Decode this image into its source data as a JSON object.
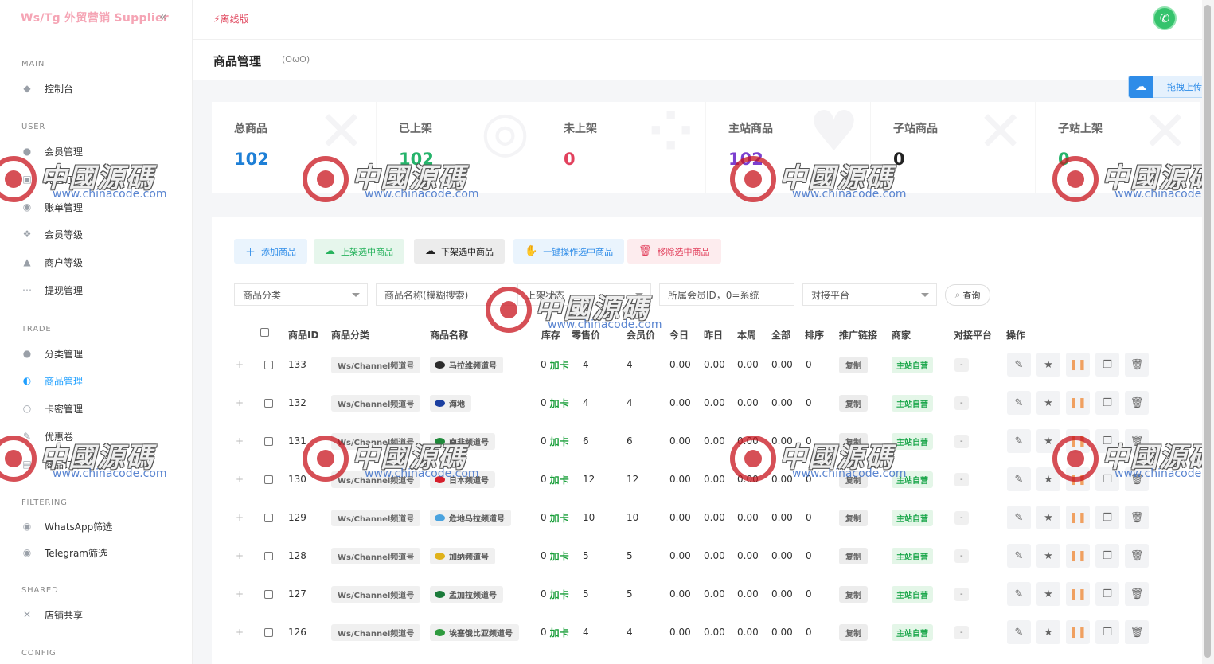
{
  "sidebar": {
    "brand": "Ws/Tg 外贸营销 Supplier",
    "sections": {
      "main": "MAIN",
      "user": "USER",
      "trade": "TRADE",
      "filtering": "FILTERING",
      "shared": "SHARED",
      "config": "CONFIG"
    },
    "items": {
      "dashboard": "控制台",
      "members": "会员管理",
      "recharge": "充值订单",
      "bills": "账单管理",
      "member_level": "会员等级",
      "merchant_level": "商户等级",
      "withdraw": "提现管理",
      "category": "分类管理",
      "products": "商品管理",
      "cardkeys": "卡密管理",
      "coupons": "优惠卷",
      "orders": "商品订单",
      "whatsapp": "WhatsApp筛选",
      "telegram": "Telegram筛选",
      "shop_share": "店铺共享"
    }
  },
  "topbar": {
    "offline": "离线版"
  },
  "page": {
    "title": "商品管理",
    "emoticon": "(OωO)"
  },
  "upload": {
    "label": "拖拽上传"
  },
  "stats": [
    {
      "label": "总商品",
      "value": "102",
      "color": "#1e7fd6"
    },
    {
      "label": "已上架",
      "value": "102",
      "color": "#25b36a"
    },
    {
      "label": "未上架",
      "value": "0",
      "color": "#e2415d"
    },
    {
      "label": "主站商品",
      "value": "102",
      "color": "#7b3fcf"
    },
    {
      "label": "子站商品",
      "value": "0",
      "color": "#222222"
    },
    {
      "label": "子站上架",
      "value": "0",
      "color": "#25b36a"
    }
  ],
  "actions": {
    "add": "添加商品",
    "list_on": "上架选中商品",
    "list_off": "下架选中商品",
    "batch": "一键操作选中商品",
    "remove": "移除选中商品"
  },
  "filters": {
    "category": "商品分类",
    "name": "商品名称(模糊搜索)",
    "status": "上架状态",
    "member_id": "所属会员ID，0=系统",
    "platform": "对接平台",
    "search": "查询"
  },
  "table": {
    "headers": {
      "id": "商品ID",
      "category": "商品分类",
      "name": "商品名称",
      "stock": "库存",
      "retail": "零售价",
      "member_price": "会员价",
      "today": "今日",
      "yesterday": "昨日",
      "week": "本周",
      "total": "全部",
      "sort": "排序",
      "promo": "推广链接",
      "merchant": "商家",
      "platform": "对接平台",
      "ops": "操作"
    },
    "rows": [
      {
        "id": "133",
        "category": "Ws/Channel频道号",
        "name": "马拉维频道号",
        "stock": "0",
        "stock_add": "加卡",
        "retail": "4",
        "member": "4",
        "today": "0.00",
        "yesterday": "0.00",
        "week": "0.00",
        "total": "0.00",
        "sort": "0",
        "promo": "复制",
        "merchant": "主站自营",
        "platform": "-",
        "flag": "#2b2b2b"
      },
      {
        "id": "132",
        "category": "Ws/Channel频道号",
        "name": "海地",
        "stock": "0",
        "stock_add": "加卡",
        "retail": "4",
        "member": "4",
        "today": "0.00",
        "yesterday": "0.00",
        "week": "0.00",
        "total": "0.00",
        "sort": "0",
        "promo": "复制",
        "merchant": "主站自营",
        "platform": "-",
        "flag": "#1b3fa0"
      },
      {
        "id": "131",
        "category": "Ws/Channel频道号",
        "name": "南非频道号",
        "stock": "0",
        "stock_add": "加卡",
        "retail": "6",
        "member": "6",
        "today": "0.00",
        "yesterday": "0.00",
        "week": "0.00",
        "total": "0.00",
        "sort": "0",
        "promo": "复制",
        "merchant": "主站自营",
        "platform": "-",
        "flag": "#1f8a3a"
      },
      {
        "id": "130",
        "category": "Ws/Channel频道号",
        "name": "日本频道号",
        "stock": "0",
        "stock_add": "加卡",
        "retail": "12",
        "member": "12",
        "today": "0.00",
        "yesterday": "0.00",
        "week": "0.00",
        "total": "0.00",
        "sort": "0",
        "promo": "复制",
        "merchant": "主站自营",
        "platform": "-",
        "flag": "#d61f2c"
      },
      {
        "id": "129",
        "category": "Ws/Channel频道号",
        "name": "危地马拉频道号",
        "stock": "0",
        "stock_add": "加卡",
        "retail": "10",
        "member": "10",
        "today": "0.00",
        "yesterday": "0.00",
        "week": "0.00",
        "total": "0.00",
        "sort": "0",
        "promo": "复制",
        "merchant": "主站自营",
        "platform": "-",
        "flag": "#4aa3df"
      },
      {
        "id": "128",
        "category": "Ws/Channel频道号",
        "name": "加纳频道号",
        "stock": "0",
        "stock_add": "加卡",
        "retail": "5",
        "member": "5",
        "today": "0.00",
        "yesterday": "0.00",
        "week": "0.00",
        "total": "0.00",
        "sort": "0",
        "promo": "复制",
        "merchant": "主站自营",
        "platform": "-",
        "flag": "#e0b21a"
      },
      {
        "id": "127",
        "category": "Ws/Channel频道号",
        "name": "孟加拉频道号",
        "stock": "0",
        "stock_add": "加卡",
        "retail": "5",
        "member": "5",
        "today": "0.00",
        "yesterday": "0.00",
        "week": "0.00",
        "total": "0.00",
        "sort": "0",
        "promo": "复制",
        "merchant": "主站自营",
        "platform": "-",
        "flag": "#1a7a3a"
      },
      {
        "id": "126",
        "category": "Ws/Channel频道号",
        "name": "埃塞俄比亚频道号",
        "stock": "0",
        "stock_add": "加卡",
        "retail": "4",
        "member": "4",
        "today": "0.00",
        "yesterday": "0.00",
        "week": "0.00",
        "total": "0.00",
        "sort": "0",
        "promo": "复制",
        "merchant": "主站自营",
        "platform": "-",
        "flag": "#2e9a3e"
      }
    ]
  },
  "watermark": {
    "title": "中國源碼",
    "url": "www.chinacode.com"
  },
  "icons": {
    "collapse": "chevrons-left-icon",
    "avatar": "wechat-icon",
    "upload": "cloud-upload-icon"
  }
}
